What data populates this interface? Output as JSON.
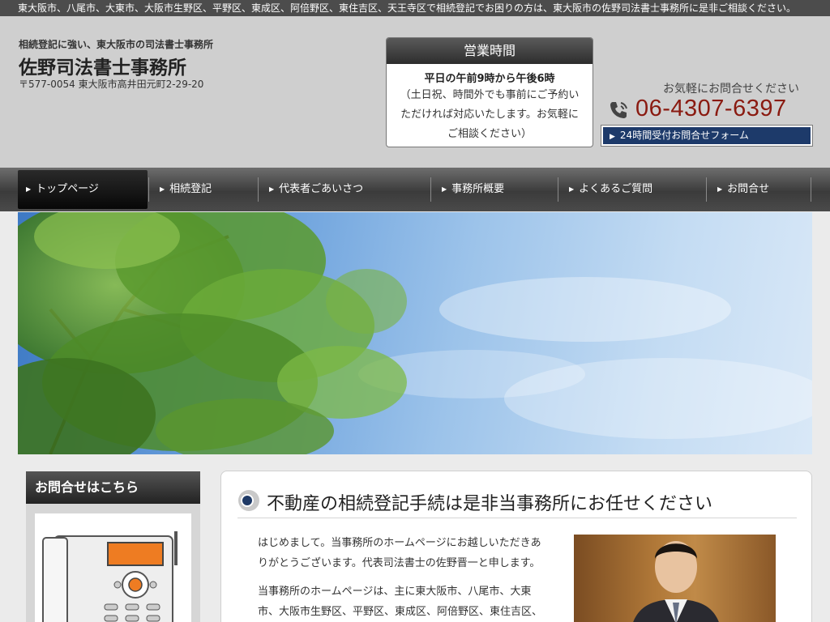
{
  "topbar": {
    "text": "東大阪市、八尾市、大東市、大阪市生野区、平野区、東成区、阿倍野区、東住吉区、天王寺区で相続登記でお困りの方は、東大阪市の佐野司法書士事務所に是非ご相談ください。"
  },
  "header": {
    "tagline": "相続登記に強い、東大阪市の司法書士事務所",
    "site_name": "佐野司法書士事務所",
    "address": "〒577-0054 東大阪市高井田元町2-29-20"
  },
  "hours": {
    "title": "営業時間",
    "main": "平日の午前9時から午後6時",
    "note_lines": [
      "（土日祝、時間外でも事前にご予約い",
      "ただければ対応いたします。お気軽に",
      "ご相談ください）"
    ]
  },
  "contact": {
    "label": "お気軽にお問合せください",
    "phone": "06-4307-6397",
    "form_button": "24時間受付お問合せフォーム"
  },
  "nav": {
    "items": [
      {
        "label": "トップページ"
      },
      {
        "label": "相続登記"
      },
      {
        "label": "代表者ごあいさつ"
      },
      {
        "label": "事務所概要"
      },
      {
        "label": "よくあるご質問"
      },
      {
        "label": "お問合せ"
      }
    ]
  },
  "sidebar": {
    "heading": "お問合せはこちら"
  },
  "main": {
    "title": "不動産の相続登記手続は是非当事務所にお任せください",
    "paragraphs": [
      {
        "lines": [
          "はじめまして。当事務所のホームページにお越しいただきあ",
          "りがとうございます。代表司法書士の佐野晋一と申します。"
        ]
      },
      {
        "lines": [
          "当事務所のホームページは、主に東大阪市、八尾市、大東",
          "市、大阪市生野区、平野区、東成区、阿倍野区、東住吉区、"
        ]
      }
    ]
  },
  "colors": {
    "phone": "#8a1a10",
    "form_button_bg": "#1d3a6a",
    "nav_bg": "#4a4a4a",
    "header_bg": "#cfcfcf"
  },
  "icons": {
    "phone": "phone-icon",
    "title_marker": "bullet-circle-icon",
    "arrow": "triangle-right-icon"
  }
}
